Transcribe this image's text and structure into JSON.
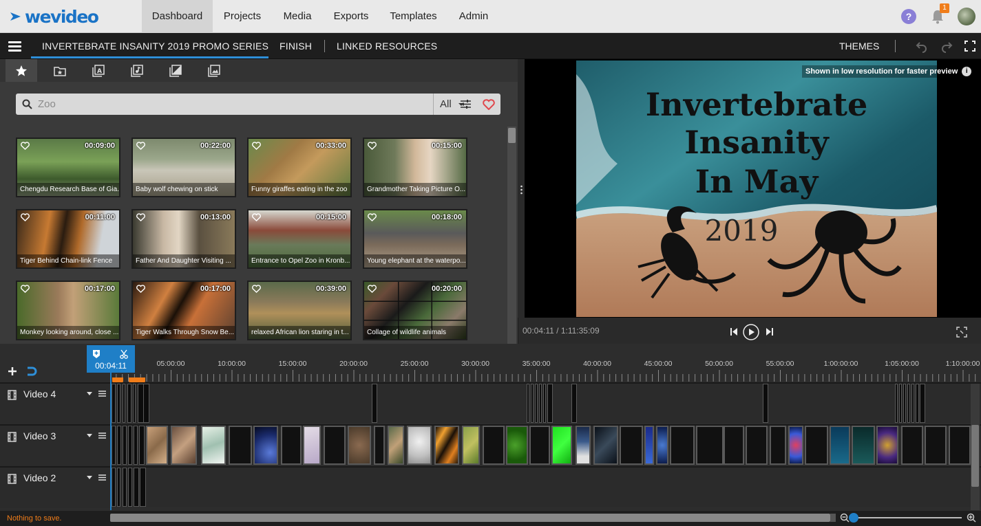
{
  "app": {
    "logo_text": "wevideo",
    "brand_color": "#1a73c6",
    "accent_color": "#2e8fd8"
  },
  "nav": {
    "tabs": [
      {
        "label": "Dashboard",
        "active": true
      },
      {
        "label": "Projects"
      },
      {
        "label": "Media"
      },
      {
        "label": "Exports"
      },
      {
        "label": "Templates"
      },
      {
        "label": "Admin"
      }
    ],
    "help": "?",
    "notifications": "1"
  },
  "subbar": {
    "project_title": "INVERTEBRATE INSANITY 2019 PROMO SERIES",
    "finish": "FINISH",
    "linked": "LINKED RESOURCES",
    "themes": "THEMES"
  },
  "library": {
    "categories": [
      "star-icon",
      "folder-star-icon",
      "text-icon",
      "music-icon",
      "transition-icon",
      "image-icon"
    ],
    "search": {
      "placeholder": "Zoo",
      "filter": "All"
    },
    "clips": [
      {
        "dur": "00:09:00",
        "title": "Chengdu Research Base of Gia..."
      },
      {
        "dur": "00:22:00",
        "title": "Baby wolf chewing on stick"
      },
      {
        "dur": "00:33:00",
        "title": "Funny giraffes eating in the zoo"
      },
      {
        "dur": "00:15:00",
        "title": "Grandmother Taking Picture O..."
      },
      {
        "dur": "00:11:00",
        "title": "Tiger Behind Chain-link Fence"
      },
      {
        "dur": "00:13:00",
        "title": "Father And Daughter Visiting ..."
      },
      {
        "dur": "00:15:00",
        "title": "Entrance to Opel Zoo in Kronb..."
      },
      {
        "dur": "00:18:00",
        "title": "Young elephant at the waterpo..."
      },
      {
        "dur": "00:17:00",
        "title": "Monkey looking around, close ..."
      },
      {
        "dur": "00:17:00",
        "title": "Tiger Walks Through Snow Be..."
      },
      {
        "dur": "00:39:00",
        "title": "relaxed African lion staring in t..."
      },
      {
        "dur": "00:20:00",
        "title": "Collage of wildlife animals"
      }
    ]
  },
  "preview": {
    "notice": "Shown in low resolution for faster preview",
    "info": "i",
    "timecode": "00:04:11 / 1:11:35:09",
    "frame_lines": [
      "Invertebrate",
      "Insanity",
      "In May",
      "2019"
    ]
  },
  "timeline": {
    "playhead": "00:04:11",
    "ticks": [
      "05:00:00",
      "10:00:00",
      "15:00:00",
      "20:00:00",
      "25:00:00",
      "30:00:00",
      "35:00:00",
      "40:00:00",
      "45:00:00",
      "50:00:00",
      "55:00:00",
      "1:00:00:00",
      "1:05:00:00",
      "1:10:00:00"
    ],
    "tracks": [
      {
        "name": "Video 4"
      },
      {
        "name": "Video 3"
      },
      {
        "name": "Video 2"
      }
    ]
  },
  "status": {
    "message": "Nothing to save."
  }
}
